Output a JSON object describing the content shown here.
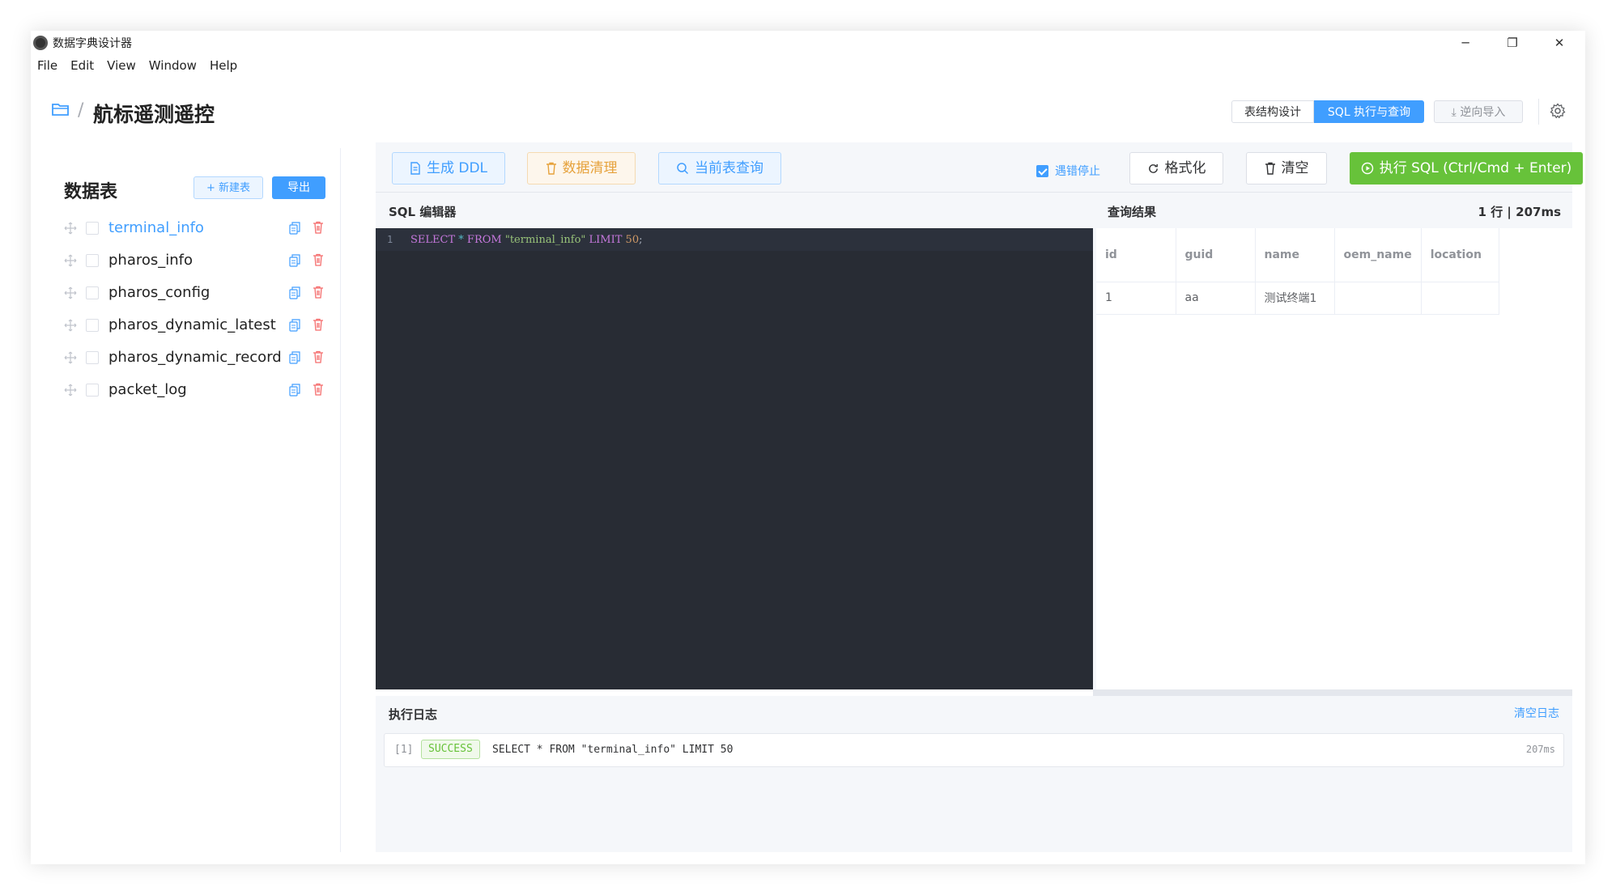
{
  "window": {
    "title": "数据字典设计器",
    "controls": {
      "minimize": "─",
      "maximize": "❐",
      "close": "✕"
    }
  },
  "menu": [
    "File",
    "Edit",
    "View",
    "Window",
    "Help"
  ],
  "header": {
    "breadcrumb_sep": "/",
    "project_title": "航标遥测遥控",
    "mode_tabs": [
      {
        "label": "表结构设计",
        "active": false
      },
      {
        "label": "SQL 执行与查询",
        "active": true
      }
    ],
    "import_label": "逆向导入",
    "icons": {
      "folder": "folder-icon",
      "settings": "gear-icon"
    }
  },
  "sidebar": {
    "title": "数据表",
    "new_table_label": "+ 新建表",
    "export_label": "导出",
    "tables": [
      {
        "name": "terminal_info",
        "active": true
      },
      {
        "name": "pharos_info",
        "active": false
      },
      {
        "name": "pharos_config",
        "active": false
      },
      {
        "name": "pharos_dynamic_latest",
        "active": false
      },
      {
        "name": "pharos_dynamic_record",
        "active": false
      },
      {
        "name": "packet_log",
        "active": false
      }
    ]
  },
  "toolbar": {
    "ddl_label": "生成 DDL",
    "clean_label": "数据清理",
    "query_current_label": "当前表查询",
    "stop_on_error_label": "遇错停止",
    "stop_on_error_checked": true,
    "format_label": "格式化",
    "clear_label": "清空",
    "execute_label": "执行 SQL (Ctrl/Cmd + Enter)"
  },
  "editor": {
    "title": "SQL 编辑器",
    "line_number": "1",
    "tokens": {
      "select": "SELECT",
      "star": "*",
      "from": "FROM",
      "table": "\"terminal_info\"",
      "limit": "LIMIT",
      "count": "50",
      "end": ";"
    }
  },
  "results": {
    "title": "查询结果",
    "meta": "1 行 | 207ms",
    "columns": [
      "id",
      "guid",
      "name",
      "oem_name",
      "location"
    ],
    "rows": [
      [
        "1",
        "aa",
        "测试终端1",
        "",
        ""
      ]
    ]
  },
  "log": {
    "title": "执行日志",
    "clear_label": "清空日志",
    "entries": [
      {
        "index": "[1]",
        "status": "SUCCESS",
        "sql": "SELECT * FROM \"terminal_info\" LIMIT 50",
        "time": "207ms"
      }
    ]
  },
  "colors": {
    "primary": "#409eff",
    "success": "#67c23a",
    "warning": "#e6a23c",
    "danger": "#f56c6c",
    "editor_bg": "#282c34"
  }
}
